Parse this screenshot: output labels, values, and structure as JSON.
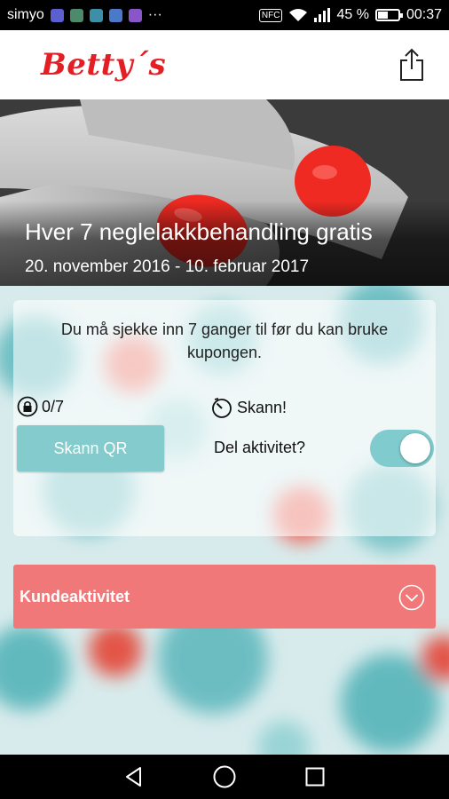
{
  "status_bar": {
    "carrier": "simyo",
    "dots": "···",
    "nfc": "NFC",
    "battery": "45 %",
    "battery_level": 0.45,
    "time": "00:37"
  },
  "app_bar": {
    "logo": "Betty´s",
    "share_icon": "share-icon"
  },
  "hero": {
    "title": "Hver 7 neglelakkbehandling gratis",
    "dates": "20. november 2016 - 10. februar 2017"
  },
  "coupon": {
    "instruction": "Du må sjekke inn  7 ganger til før du kan bruke kupongen.",
    "counter": "0/7",
    "scan_status": "Skann!",
    "scan_button": "Skann QR",
    "share_activity_label": "Del aktivitet?",
    "share_activity_on": true
  },
  "activity": {
    "label": "Kundeaktivitet"
  },
  "colors": {
    "brand_red": "#e41e25",
    "teal": "#83cbcc",
    "activity_bar": "#f07878"
  }
}
